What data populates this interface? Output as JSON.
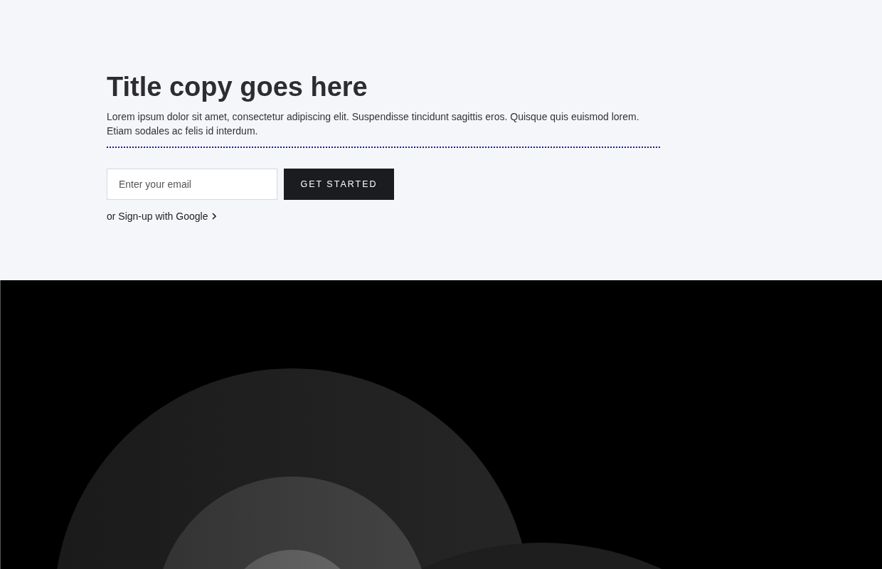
{
  "hero": {
    "title": "Title copy goes here",
    "text": "Lorem ipsum dolor sit amet, consectetur adipiscing elit. Suspendisse tincidunt sagittis eros. Quisque quis euismod lorem. Etiam sodales ac felis id interdum.",
    "email": {
      "placeholder": "Enter your email"
    },
    "button": "GET STARTED",
    "google_link": "or Sign-up with Google"
  }
}
